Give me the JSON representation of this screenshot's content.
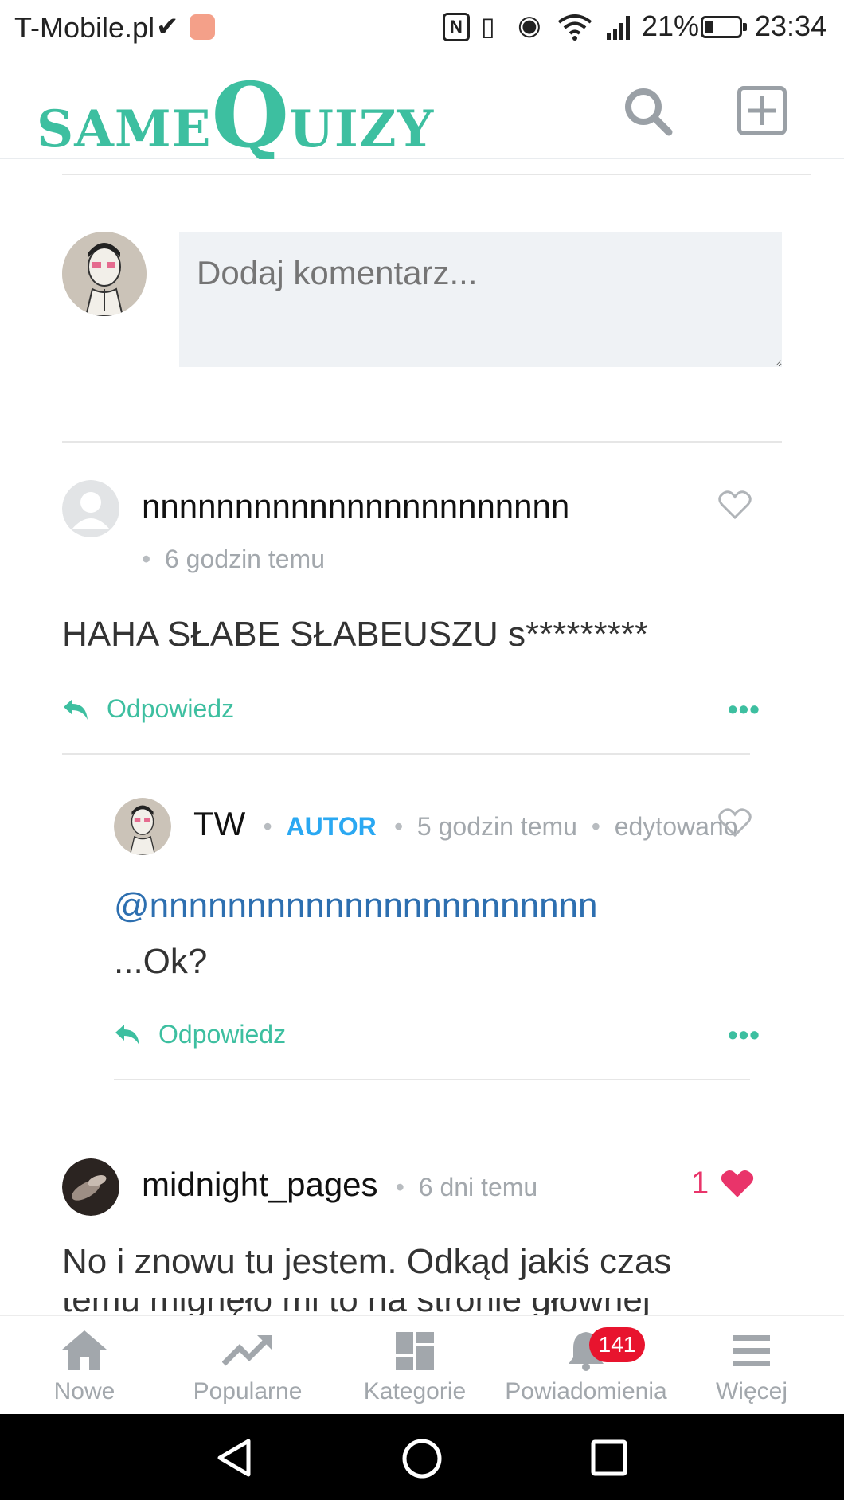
{
  "status_bar": {
    "carrier": "T-Mobile.pl",
    "battery_percent": "21%",
    "time": "23:34"
  },
  "header": {
    "logo_small": "SAME",
    "logo_big": "Q",
    "logo_rest": "UIZY"
  },
  "comment_form": {
    "placeholder": "Dodaj komentarz..."
  },
  "comments": [
    {
      "username": "nnnnnnnnnnnnnnnnnnnnnnn",
      "time": "6 godzin temu",
      "text": "HAHA SŁABE SŁABEUSZU s*********",
      "reply_label": "Odpowiedz"
    },
    {
      "username": "TW",
      "role": "AUTOR",
      "time": "5 godzin temu",
      "edited": "edytowano",
      "mention": "@nnnnnnnnnnnnnnnnnnnnnnn",
      "text": "...Ok?",
      "reply_label": "Odpowiedz"
    },
    {
      "username": "midnight_pages",
      "time": "6 dni temu",
      "likes": "1",
      "text": "No i znowu tu jestem. Odkąd jakiś czas",
      "text_cut": "temu mignęło mi to na stronie głównej"
    }
  ],
  "bottom_nav": {
    "items": [
      {
        "label": "Nowe",
        "icon": "home-icon"
      },
      {
        "label": "Popularne",
        "icon": "trending-icon"
      },
      {
        "label": "Kategorie",
        "icon": "grid-icon"
      },
      {
        "label": "Powiadomienia",
        "icon": "bell-icon",
        "badge": "141"
      },
      {
        "label": "Więcej",
        "icon": "menu-icon"
      }
    ]
  },
  "colors": {
    "brand": "#3dbfa0",
    "author": "#2aa8f2",
    "heart": "#e9346a",
    "badge": "#e8142e"
  }
}
